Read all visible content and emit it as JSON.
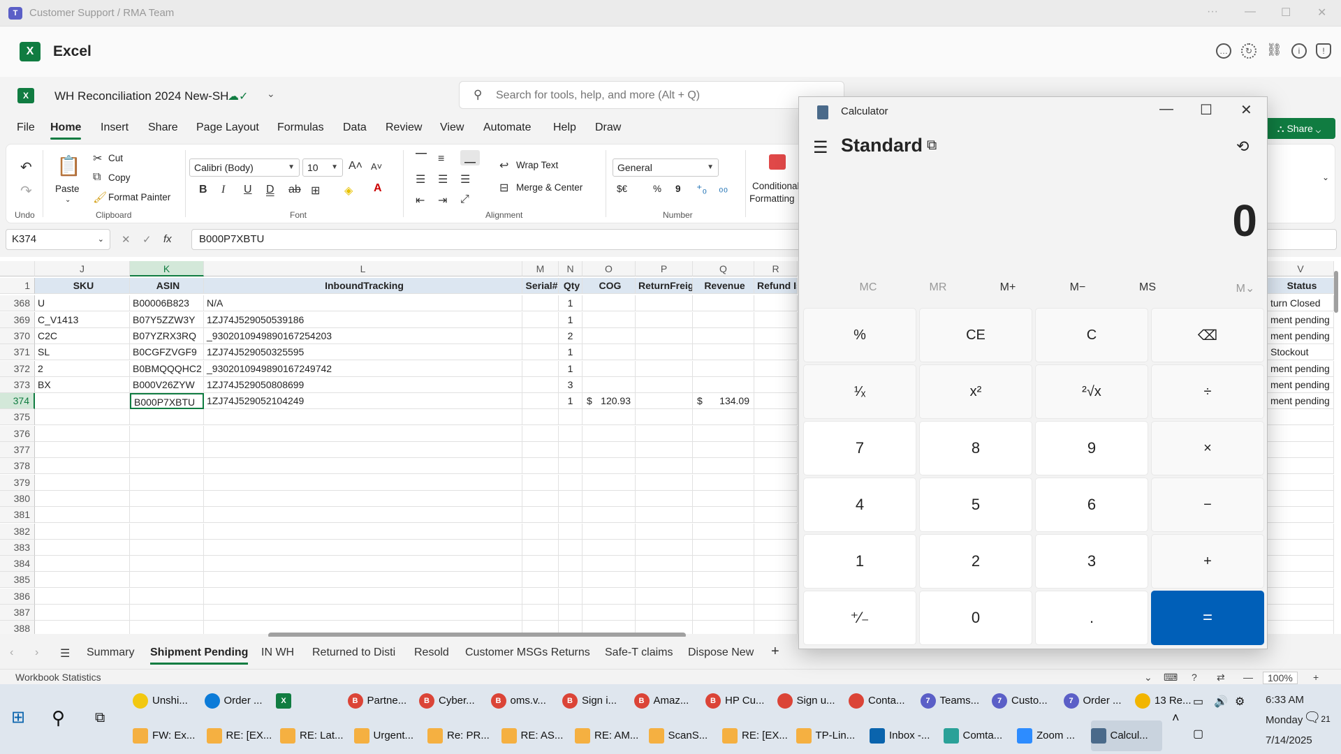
{
  "teams": {
    "title": "Customer Support / RMA Team",
    "more": "···",
    "min": "—",
    "max": "☐",
    "close": "✕"
  },
  "app": {
    "name": "Excel",
    "logo": "X"
  },
  "doc": {
    "title": "WH Reconciliation 2024 New-SH",
    "saved_icon": "cloud-check-icon"
  },
  "search": {
    "placeholder": "Search for tools, help, and more (Alt + Q)"
  },
  "ribbon_tabs": [
    "File",
    "Home",
    "Insert",
    "Share",
    "Page Layout",
    "Formulas",
    "Data",
    "Review",
    "View",
    "Automate",
    "Help",
    "Draw"
  ],
  "share_label": "Share",
  "ribbon": {
    "undo": "Undo",
    "clipboard": "Clipboard",
    "paste": "Paste",
    "cut": "Cut",
    "copy": "Copy",
    "format_painter": "Format Painter",
    "font_name": "Calibri (Body)",
    "font_size": "10",
    "font": "Font",
    "wrap_text": "Wrap Text",
    "merge_center": "Merge & Center",
    "alignment": "Alignment",
    "number_format": "General",
    "number": "Number",
    "currency": "$€",
    "percent": "%",
    "comma": "9",
    "cond_fmt_1": "Conditional",
    "cond_fmt_2": "Formatting",
    "bold": "B",
    "italic": "I",
    "underline": "U",
    "dunder": "D",
    "strike": "ab"
  },
  "namebox": "K374",
  "formula": "B000P7XBTU",
  "columns": [
    {
      "id": "J",
      "header": "SKU"
    },
    {
      "id": "K",
      "header": "ASIN"
    },
    {
      "id": "L",
      "header": "InboundTracking"
    },
    {
      "id": "M",
      "header": "Serial#"
    },
    {
      "id": "N",
      "header": "Qty"
    },
    {
      "id": "O",
      "header": "COG"
    },
    {
      "id": "P",
      "header": "ReturnFreigh"
    },
    {
      "id": "Q",
      "header": "Revenue"
    },
    {
      "id": "R",
      "header": "Refund Is"
    },
    {
      "id": "V",
      "header": "Status"
    }
  ],
  "header_row": "1",
  "rows": [
    {
      "n": "368",
      "J": "U",
      "K": "B00006B823",
      "L": "N/A",
      "N": "1",
      "O": "",
      "Q": "",
      "V": "turn Closed"
    },
    {
      "n": "369",
      "J": "C_V1413",
      "K": "B07Y5ZZW3Y",
      "L": "1ZJ74J529050539186",
      "N": "1",
      "O": "",
      "Q": "",
      "V": "ment pending"
    },
    {
      "n": "370",
      "J": "C2C",
      "K": "B07YZRX3RQ",
      "L": "_9302010949890167254203",
      "N": "2",
      "O": "",
      "Q": "",
      "V": "ment pending"
    },
    {
      "n": "371",
      "J": "SL",
      "K": "B0CGFZVGF9",
      "L": "1ZJ74J529050325595",
      "N": "1",
      "O": "",
      "Q": "",
      "V": "Stockout"
    },
    {
      "n": "372",
      "J": "2",
      "K": "B0BMQQQHC2",
      "L": "_9302010949890167249742",
      "N": "1",
      "O": "",
      "Q": "",
      "V": "ment pending"
    },
    {
      "n": "373",
      "J": "BX",
      "K": "B000V26ZYW",
      "L": "1ZJ74J529050808699",
      "N": "3",
      "O": "",
      "Q": "",
      "V": "ment pending"
    },
    {
      "n": "374",
      "J": "",
      "K": "B000P7XBTU",
      "L": "1ZJ74J529052104249",
      "N": "1",
      "O": "120.93",
      "Q": "134.09",
      "V": "ment pending"
    }
  ],
  "empty_rows": [
    "375",
    "376",
    "377",
    "378",
    "379",
    "380",
    "381",
    "382",
    "383",
    "384",
    "385",
    "386",
    "387",
    "388"
  ],
  "currency_symbol": "$",
  "sheets": [
    "Summary",
    "Shipment Pending",
    "IN WH",
    "Returned to Disti",
    "Resold",
    "Customer MSGs Returns",
    "Safe-T claims",
    "Dispose New"
  ],
  "add_sheet": "+",
  "status": {
    "left": "Workbook Statistics",
    "zoom": "100%",
    "minus": "—",
    "plus": "+"
  },
  "taskbar_top": [
    {
      "label": "Unshi...",
      "color": "#f2c811",
      "icon": ""
    },
    {
      "label": "Order ...",
      "color": "#0c7bd8",
      "icon": ""
    },
    {
      "label": "",
      "color": "#107c41",
      "icon": "X"
    },
    {
      "label": "Partne...",
      "color": "#db4437",
      "icon": "B"
    },
    {
      "label": "Cyber...",
      "color": "#db4437",
      "icon": "B"
    },
    {
      "label": "oms.v...",
      "color": "#db4437",
      "icon": "B"
    },
    {
      "label": "Sign i...",
      "color": "#db4437",
      "icon": "B"
    },
    {
      "label": "Amaz...",
      "color": "#db4437",
      "icon": "B"
    },
    {
      "label": "HP Cu...",
      "color": "#db4437",
      "icon": "B"
    },
    {
      "label": "Sign u...",
      "color": "#db4437",
      "icon": ""
    },
    {
      "label": "Conta...",
      "color": "#db4437",
      "icon": ""
    },
    {
      "label": "Teams...",
      "color": "#5b5fc7",
      "icon": "7"
    },
    {
      "label": "Custo...",
      "color": "#5b5fc7",
      "icon": "7"
    },
    {
      "label": "Order ...",
      "color": "#5b5fc7",
      "icon": "7"
    },
    {
      "label": "13 Re...",
      "color": "#f2b500",
      "icon": ""
    }
  ],
  "taskbar_bottom": [
    {
      "label": "FW: Ex...",
      "color": "#f5b041"
    },
    {
      "label": "RE: [EX...",
      "color": "#f5b041"
    },
    {
      "label": "RE: Lat...",
      "color": "#f5b041"
    },
    {
      "label": "Urgent...",
      "color": "#f5b041"
    },
    {
      "label": "Re: PR...",
      "color": "#f5b041"
    },
    {
      "label": "RE: AS...",
      "color": "#f5b041"
    },
    {
      "label": "RE: AM...",
      "color": "#f5b041"
    },
    {
      "label": "ScanS...",
      "color": "#f5b041"
    },
    {
      "label": "RE: [EX...",
      "color": "#f5b041"
    },
    {
      "label": "TP-Lin...",
      "color": "#f5b041"
    },
    {
      "label": "Inbox -...",
      "color": "#0a64ad"
    },
    {
      "label": "Comta...",
      "color": "#2aa198"
    },
    {
      "label": "Zoom ...",
      "color": "#2d8cff"
    },
    {
      "label": "Calcul...",
      "color": "#4a6a8a"
    }
  ],
  "clock": {
    "time": "6:33 AM",
    "day": "Monday",
    "date": "7/14/2025"
  },
  "notif_count": "21",
  "calc": {
    "title": "Calculator",
    "mode": "Standard",
    "display": "0",
    "memory": [
      "MC",
      "MR",
      "M+",
      "M−",
      "MS",
      "M⌄"
    ],
    "keys": [
      [
        "%",
        "CE",
        "C",
        "⌫"
      ],
      [
        "¹⁄ₓ",
        "x²",
        "²√x",
        "÷"
      ],
      [
        "7",
        "8",
        "9",
        "×"
      ],
      [
        "4",
        "5",
        "6",
        "−"
      ],
      [
        "1",
        "2",
        "3",
        "+"
      ],
      [
        "⁺⁄₋",
        "0",
        ".",
        "="
      ]
    ]
  }
}
